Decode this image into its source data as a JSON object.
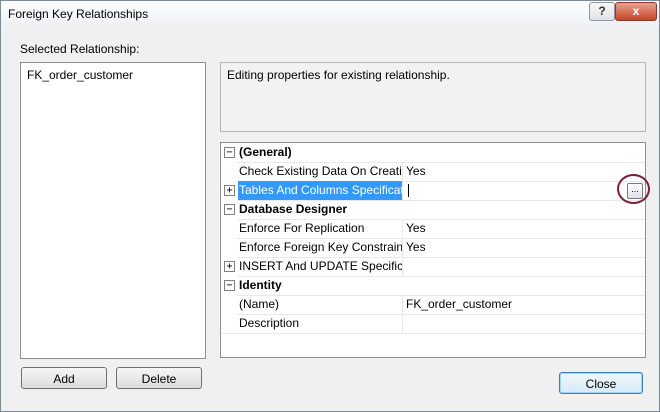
{
  "window": {
    "title": "Foreign Key Relationships",
    "help_label": "?",
    "close_label": "x"
  },
  "left": {
    "label": "Selected Relationship:",
    "items": [
      "FK_order_customer"
    ]
  },
  "description": "Editing properties for existing relationship.",
  "properties": [
    {
      "type": "category",
      "name": "(General)",
      "expander": "−"
    },
    {
      "type": "prop",
      "name": "Check Existing Data On Creation Or Re-Enabling",
      "value": "Yes"
    },
    {
      "type": "prop",
      "name": "Tables And Columns Specification",
      "value": "",
      "expander": "+",
      "selected": true,
      "ellipsis": "..."
    },
    {
      "type": "category",
      "name": "Database Designer",
      "expander": "−"
    },
    {
      "type": "prop",
      "name": "Enforce For Replication",
      "value": "Yes"
    },
    {
      "type": "prop",
      "name": "Enforce Foreign Key Constraint",
      "value": "Yes"
    },
    {
      "type": "prop",
      "name": "INSERT And UPDATE Specification",
      "value": "",
      "expander": "+"
    },
    {
      "type": "category",
      "name": "Identity",
      "expander": "−"
    },
    {
      "type": "prop",
      "name": "(Name)",
      "value": "FK_order_customer"
    },
    {
      "type": "prop",
      "name": "Description",
      "value": ""
    }
  ],
  "buttons": {
    "add": "Add",
    "delete": "Delete",
    "close": "Close"
  },
  "colors": {
    "selection": "#3399ff",
    "highlight_circle": "#7b1e3a"
  }
}
